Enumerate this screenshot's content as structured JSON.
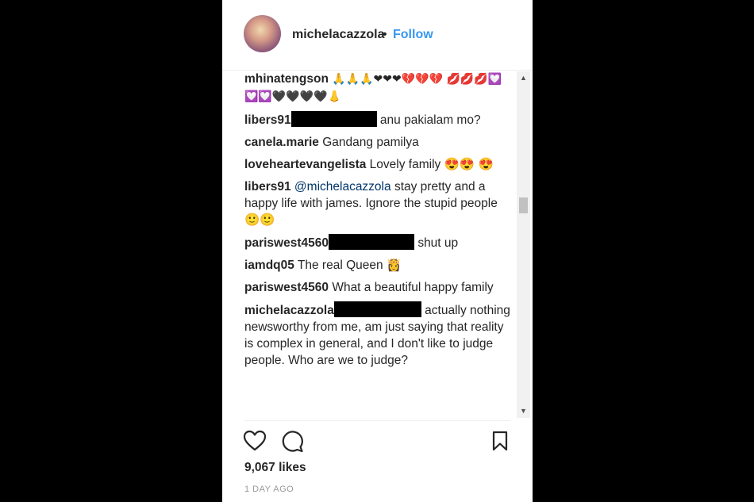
{
  "post": {
    "username": "michelacazzola",
    "separator": "•",
    "follow_label": "Follow"
  },
  "comments": [
    {
      "user": "mhinatengson",
      "text": "🙏🙏🙏❤❤❤💔💔💔 💋💋💋💟💟💟🖤🖤🖤🖤👃"
    },
    {
      "user": "libers91",
      "redacted": true,
      "text": "anu pakialam mo?"
    },
    {
      "user": "canela.marie",
      "text": "Gandang pamilya"
    },
    {
      "user": "loveheartevangelista",
      "text": "Lovely family 😍😍 😍"
    },
    {
      "user": "libers91",
      "mention": "@michelacazzola",
      "text": "stay pretty and a happy life with james. Ignore the stupid people 🙂🙂"
    },
    {
      "user": "pariswest4560",
      "redacted": true,
      "text": "shut up"
    },
    {
      "user": "iamdq05",
      "text": "The real Queen 👸"
    },
    {
      "user": "pariswest4560",
      "text": "What a beautiful happy family"
    },
    {
      "user": "michelacazzola",
      "redacted": true,
      "text": "actually nothing newsworthy from me, am just saying that reality is complex in general, and I don't like to judge people. Who are we to judge?"
    }
  ],
  "actions": {
    "like_icon": "heart-icon",
    "comment_icon": "comment-bubble-icon",
    "save_icon": "bookmark-icon"
  },
  "stats": {
    "likes": "9,067 likes",
    "time": "1 DAY AGO"
  },
  "scrollbar": {
    "up_arrow": "▲",
    "down_arrow": "▼"
  }
}
